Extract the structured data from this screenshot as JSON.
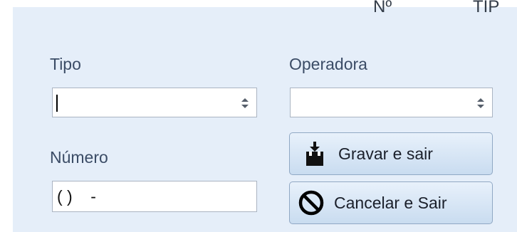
{
  "header": {
    "col1_partial": "Nº",
    "col2_partial": "TIP"
  },
  "form": {
    "tipo": {
      "label": "Tipo",
      "value": ""
    },
    "operadora": {
      "label": "Operadora",
      "value": ""
    },
    "numero": {
      "label": "Número",
      "value": "( )    -"
    }
  },
  "buttons": {
    "save_label": "Gravar e sair",
    "save_icon": "save-download-icon",
    "cancel_label": "Cancelar e Sair",
    "cancel_icon": "cancel-circle-icon"
  },
  "colors": {
    "panel_bg": "#e5eef9",
    "label_text": "#3b4c66",
    "button_gradient_top": "#e8f1fb",
    "button_gradient_bottom": "#c9dcf0"
  }
}
